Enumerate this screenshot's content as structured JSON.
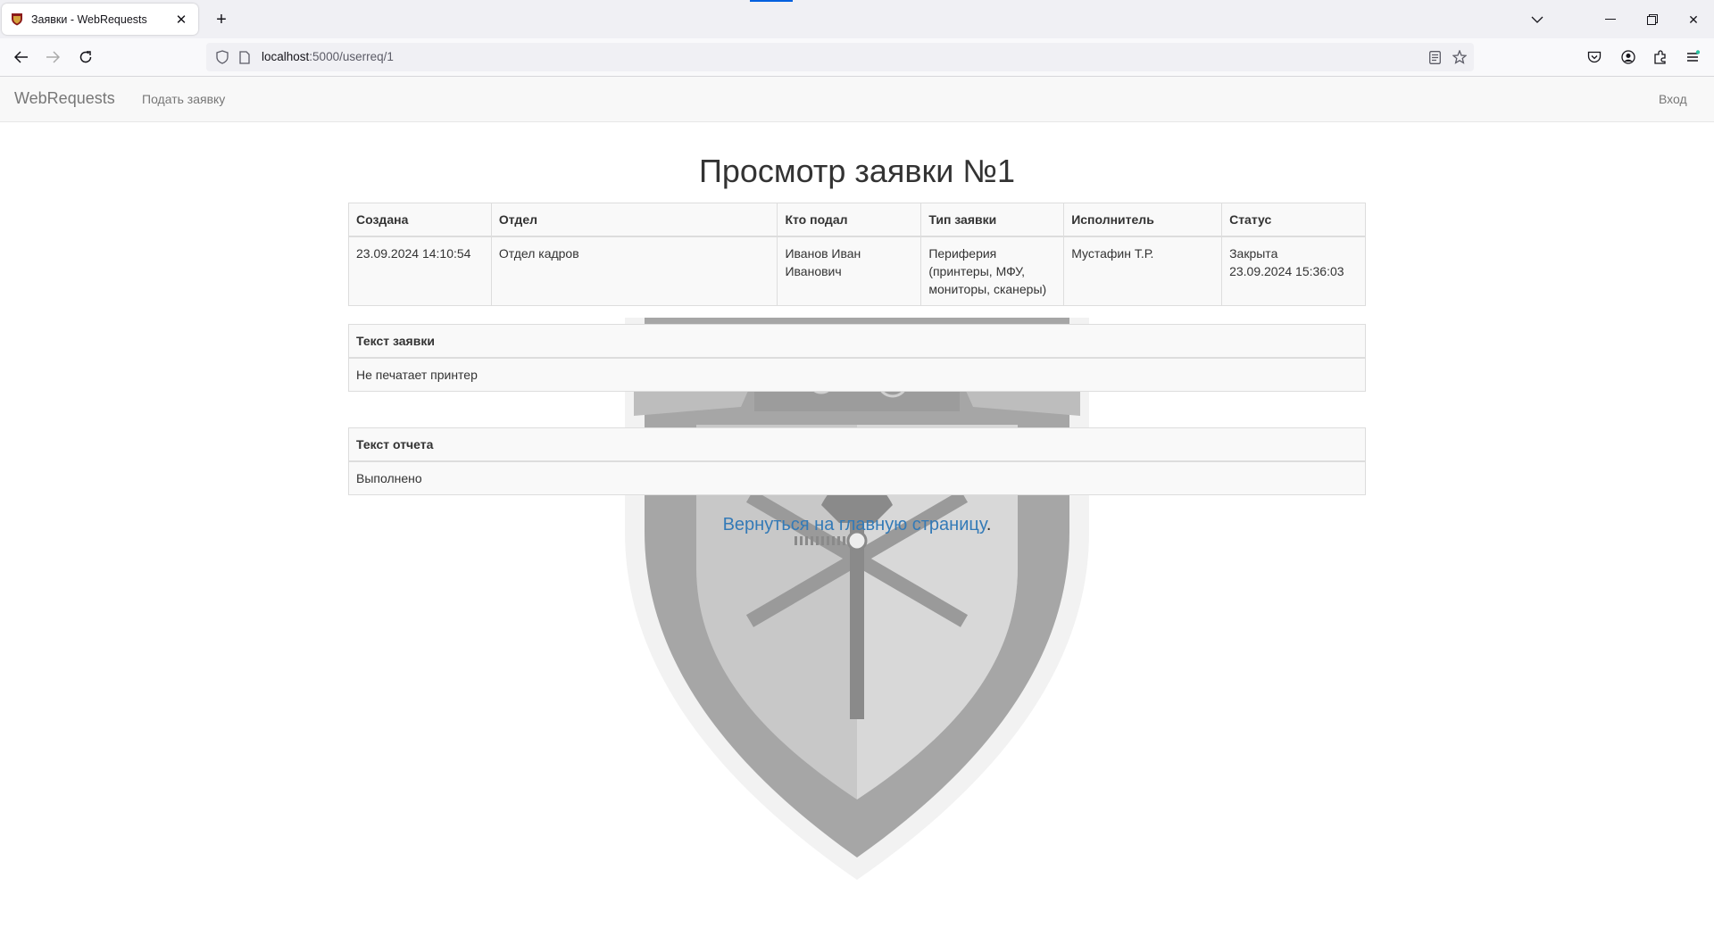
{
  "browser": {
    "tab_title": "Заявки - WebRequests",
    "url_host": "localhost",
    "url_rest": ":5000/userreq/1"
  },
  "site": {
    "brand": "WebRequests",
    "nav_submit": "Подать заявку",
    "nav_login": "Вход"
  },
  "page": {
    "title": "Просмотр заявки №1",
    "columns": [
      "Создана",
      "Отдел",
      "Кто подал",
      "Тип заявки",
      "Исполнитель",
      "Статус"
    ],
    "row": {
      "created": "23.09.2024 14:10:54",
      "department": "Отдел кадров",
      "author_line1": "Иванов Иван",
      "author_line2": "Иванович",
      "type_line1": "Периферия",
      "type_line2": "(принтеры, МФУ,",
      "type_line3": "мониторы, сканеры)",
      "executor": "Мустафин Т.Р.",
      "status_line1": "Закрыта",
      "status_line2": "23.09.2024 15:36:03"
    },
    "request_text_header": "Текст заявки",
    "request_text": "Не печатает принтер",
    "report_text_header": "Текст отчета",
    "report_text": "Выполнено",
    "back_link": "Вернуться на главную страницу",
    "back_suffix": "."
  },
  "colors": {
    "link": "#337ab7",
    "navbar_bg": "#f8f8f8",
    "table_bg": "#f9f9f9"
  },
  "icons": [
    "tab-favicon-shield-icon",
    "close-icon",
    "plus-icon",
    "back-arrow-icon",
    "forward-arrow-icon",
    "reload-icon",
    "shield-icon",
    "page-icon",
    "reader-view-icon",
    "bookmark-star-icon",
    "pocket-icon",
    "account-icon",
    "extensions-icon",
    "menu-icon",
    "chevron-down-icon",
    "minimize-icon",
    "maximize-icon",
    "close-window-icon"
  ]
}
